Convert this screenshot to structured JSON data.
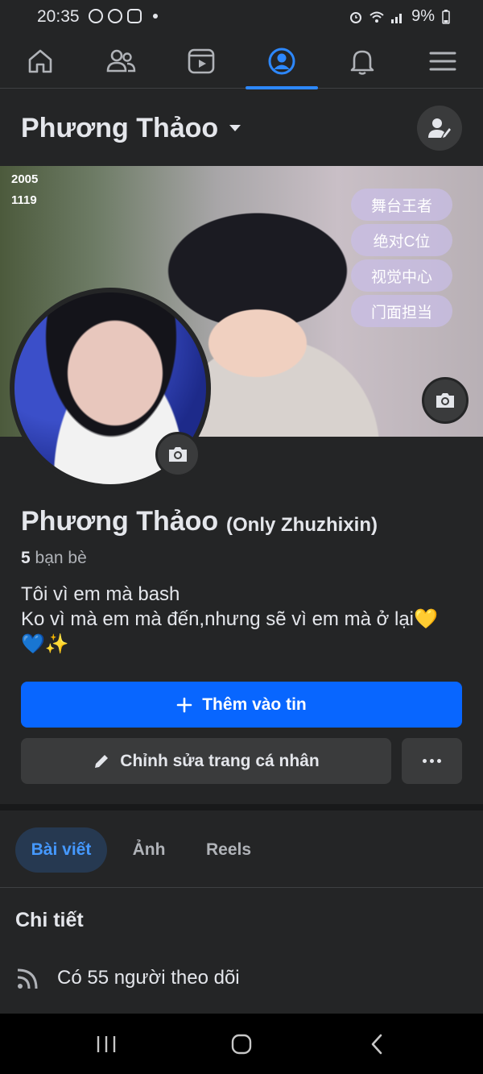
{
  "status_bar": {
    "time": "20:35",
    "battery": "9%",
    "icons": [
      "weibo-icon",
      "messenger-icon",
      "instagram-icon",
      "alarm-icon",
      "wifi-icon",
      "signal-icon",
      "battery-icon"
    ]
  },
  "nav": {
    "items": [
      {
        "name": "home",
        "icon": "home-icon"
      },
      {
        "name": "friends",
        "icon": "friends-icon"
      },
      {
        "name": "video",
        "icon": "video-icon"
      },
      {
        "name": "profile",
        "icon": "profile-icon",
        "active": true
      },
      {
        "name": "notifications",
        "icon": "bell-icon"
      },
      {
        "name": "menu",
        "icon": "hamburger-icon"
      }
    ],
    "accent": "#2d88ff"
  },
  "header": {
    "title": "Phương Thảoo"
  },
  "cover": {
    "stamp_line1": "2005",
    "stamp_line2": "1119",
    "tags": [
      "舞台王者",
      "绝对C位",
      "视觉中心",
      "门面担当"
    ]
  },
  "profile": {
    "name": "Phương Thảoo",
    "alt_name": "(Only Zhuzhixin)",
    "friends_count": "5",
    "friends_label": "bạn bè",
    "bio_line1": "Tôi vì em mà bash",
    "bio_line2": "Ko vì mà em mà đến,nhưng sẽ vì em mà ở lại💛",
    "bio_line3": "💙✨"
  },
  "buttons": {
    "add_story": "Thêm vào tin",
    "edit_profile": "Chỉnh sửa trang cá nhân"
  },
  "tabs": [
    "Bài viết",
    "Ảnh",
    "Reels"
  ],
  "details": {
    "title": "Chi tiết",
    "followers": "Có 55 người theo dõi"
  },
  "colors": {
    "background": "#242526",
    "primary_button": "#0866ff",
    "secondary_button": "#3a3b3c",
    "active_tab_bg": "#263951",
    "active_tab_text": "#4599ff"
  }
}
